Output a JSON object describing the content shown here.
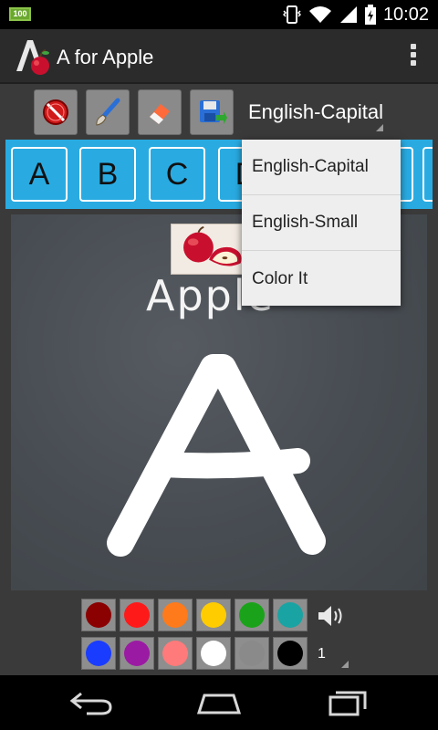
{
  "status_bar": {
    "notification_badge": "100",
    "time": "10:02",
    "icons": [
      "vibrate-icon",
      "wifi-icon",
      "signal-icon",
      "battery-icon"
    ]
  },
  "action_bar": {
    "title": "A for Apple",
    "logo_icon": "apple-logo-icon",
    "overflow_icon": "overflow-menu-icon"
  },
  "toolbar": {
    "tools": [
      "clear-icon",
      "brush-icon",
      "eraser-icon",
      "save-icon"
    ],
    "spinner_value": "English-Capital"
  },
  "letters": [
    "A",
    "B",
    "C",
    "D",
    "",
    "",
    ""
  ],
  "board": {
    "word": "Apple",
    "letter": "A",
    "chalk_color": "#ffffff"
  },
  "palette": {
    "row1": [
      "#8b0000",
      "#ff1a1a",
      "#ff7a1a",
      "#ffcc00",
      "#1aa31a",
      "#1aa3a3"
    ],
    "row2": [
      "#1a3cff",
      "#9b1aa3",
      "#ff7a7a",
      "#ffffff",
      "#8a8a8a",
      "#000000"
    ],
    "speaker_icon": "speaker-icon",
    "brush_size": "1"
  },
  "dropdown": {
    "items": [
      "English-Capital",
      "English-Small",
      "Color It"
    ]
  },
  "nav_bar": {
    "icons": [
      "back-icon",
      "home-icon",
      "recents-icon"
    ]
  }
}
